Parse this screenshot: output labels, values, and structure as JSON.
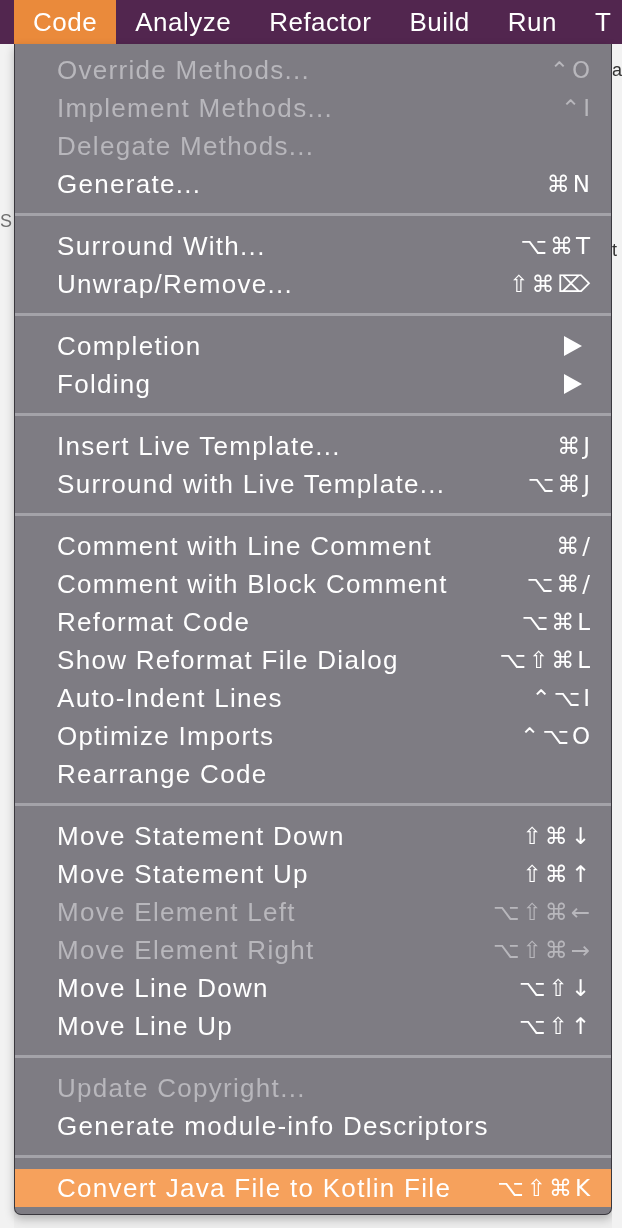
{
  "menu_bar": {
    "items": [
      {
        "label": "Code",
        "selected": true
      },
      {
        "label": "Analyze",
        "selected": false
      },
      {
        "label": "Refactor",
        "selected": false
      },
      {
        "label": "Build",
        "selected": false
      },
      {
        "label": "Run",
        "selected": false
      },
      {
        "label": "T",
        "selected": false
      }
    ]
  },
  "background_window": {
    "left_texts": [
      "S"
    ],
    "right_texts": [
      "a",
      "t"
    ]
  },
  "menu": {
    "groups": [
      {
        "items": [
          {
            "label": "Override Methods...",
            "kind": "command",
            "shortcut": "⌃O",
            "disabled": true,
            "selected": false
          },
          {
            "label": "Implement Methods...",
            "kind": "command",
            "shortcut": "⌃I",
            "disabled": true,
            "selected": false
          },
          {
            "label": "Delegate Methods...",
            "kind": "command",
            "disabled": true,
            "selected": false
          },
          {
            "label": "Generate...",
            "kind": "command",
            "shortcut": "⌘N",
            "disabled": false,
            "selected": false
          }
        ]
      },
      {
        "items": [
          {
            "label": "Surround With...",
            "kind": "command",
            "shortcut": "⌥⌘T",
            "disabled": false,
            "selected": false
          },
          {
            "label": "Unwrap/Remove...",
            "kind": "command",
            "shortcut": "⇧⌘⌦",
            "disabled": false,
            "selected": false
          }
        ]
      },
      {
        "items": [
          {
            "label": "Completion",
            "kind": "submenu",
            "disabled": false,
            "selected": false
          },
          {
            "label": "Folding",
            "kind": "submenu",
            "disabled": false,
            "selected": false
          }
        ]
      },
      {
        "items": [
          {
            "label": "Insert Live Template...",
            "kind": "command",
            "shortcut": "⌘J",
            "disabled": false,
            "selected": false
          },
          {
            "label": "Surround with Live Template...",
            "kind": "command",
            "shortcut": "⌥⌘J",
            "disabled": false,
            "selected": false
          }
        ]
      },
      {
        "items": [
          {
            "label": "Comment with Line Comment",
            "kind": "command",
            "shortcut": "⌘/",
            "disabled": false,
            "selected": false
          },
          {
            "label": "Comment with Block Comment",
            "kind": "command",
            "shortcut": "⌥⌘/",
            "disabled": false,
            "selected": false
          },
          {
            "label": "Reformat Code",
            "kind": "command",
            "shortcut": "⌥⌘L",
            "disabled": false,
            "selected": false
          },
          {
            "label": "Show Reformat File Dialog",
            "kind": "command",
            "shortcut": "⌥⇧⌘L",
            "disabled": false,
            "selected": false
          },
          {
            "label": "Auto-Indent Lines",
            "kind": "command",
            "shortcut": "⌃⌥I",
            "disabled": false,
            "selected": false
          },
          {
            "label": "Optimize Imports",
            "kind": "command",
            "shortcut": "⌃⌥O",
            "disabled": false,
            "selected": false
          },
          {
            "label": "Rearrange Code",
            "kind": "command",
            "disabled": false,
            "selected": false
          }
        ]
      },
      {
        "items": [
          {
            "label": "Move Statement Down",
            "kind": "command",
            "shortcut": "⇧⌘↓",
            "disabled": false,
            "selected": false
          },
          {
            "label": "Move Statement Up",
            "kind": "command",
            "shortcut": "⇧⌘↑",
            "disabled": false,
            "selected": false
          },
          {
            "label": "Move Element Left",
            "kind": "command",
            "shortcut": "⌥⇧⌘←",
            "disabled": true,
            "selected": false
          },
          {
            "label": "Move Element Right",
            "kind": "command",
            "shortcut": "⌥⇧⌘→",
            "disabled": true,
            "selected": false
          },
          {
            "label": "Move Line Down",
            "kind": "command",
            "shortcut": "⌥⇧↓",
            "disabled": false,
            "selected": false
          },
          {
            "label": "Move Line Up",
            "kind": "command",
            "shortcut": "⌥⇧↑",
            "disabled": false,
            "selected": false
          }
        ]
      },
      {
        "items": [
          {
            "label": "Update Copyright...",
            "kind": "command",
            "disabled": true,
            "selected": false
          },
          {
            "label": "Generate module-info Descriptors",
            "kind": "command",
            "disabled": false,
            "selected": false
          }
        ]
      },
      {
        "items": [
          {
            "label": "Convert Java File to Kotlin File",
            "kind": "command",
            "shortcut": "⌥⇧⌘K",
            "disabled": false,
            "selected": true
          }
        ]
      }
    ]
  }
}
